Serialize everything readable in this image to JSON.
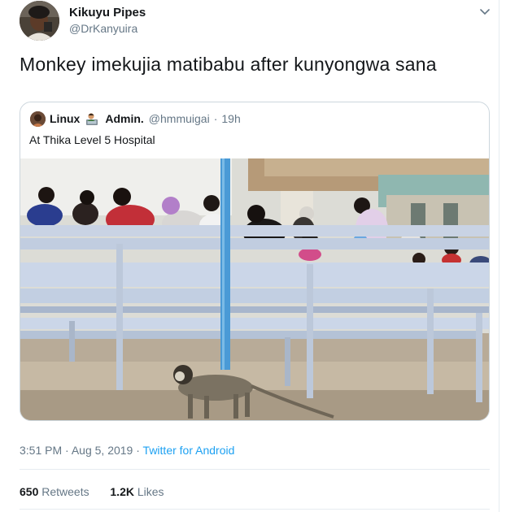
{
  "author": {
    "name": "Kikuyu Pipes",
    "handle": "@DrKanyuira"
  },
  "tweet": {
    "text": "Monkey imekujia matibabu after kunyongwa sana"
  },
  "quoted_tweet": {
    "name": "Linux",
    "emoji": "man-technologist-emoji",
    "name_suffix": "Admin.",
    "handle": "@hmmuigai",
    "separator": "·",
    "time": "19h",
    "text": "At Thika Level 5 Hospital"
  },
  "meta": {
    "time": "3:51 PM",
    "separator1": "·",
    "date": "Aug 5, 2019",
    "separator2": "·",
    "source": "Twitter for Android"
  },
  "stats": {
    "retweets_count": "650",
    "retweets_label": "Retweets",
    "likes_count": "1.2K",
    "likes_label": "Likes"
  },
  "colors": {
    "link": "#1da1f2",
    "secondary_text": "#657786",
    "border": "#ccd6dd",
    "bench_blue": "#c9d6ea",
    "pillar_blue": "#4a9ad6"
  },
  "icons": {
    "caret": "chevron-down-icon"
  }
}
